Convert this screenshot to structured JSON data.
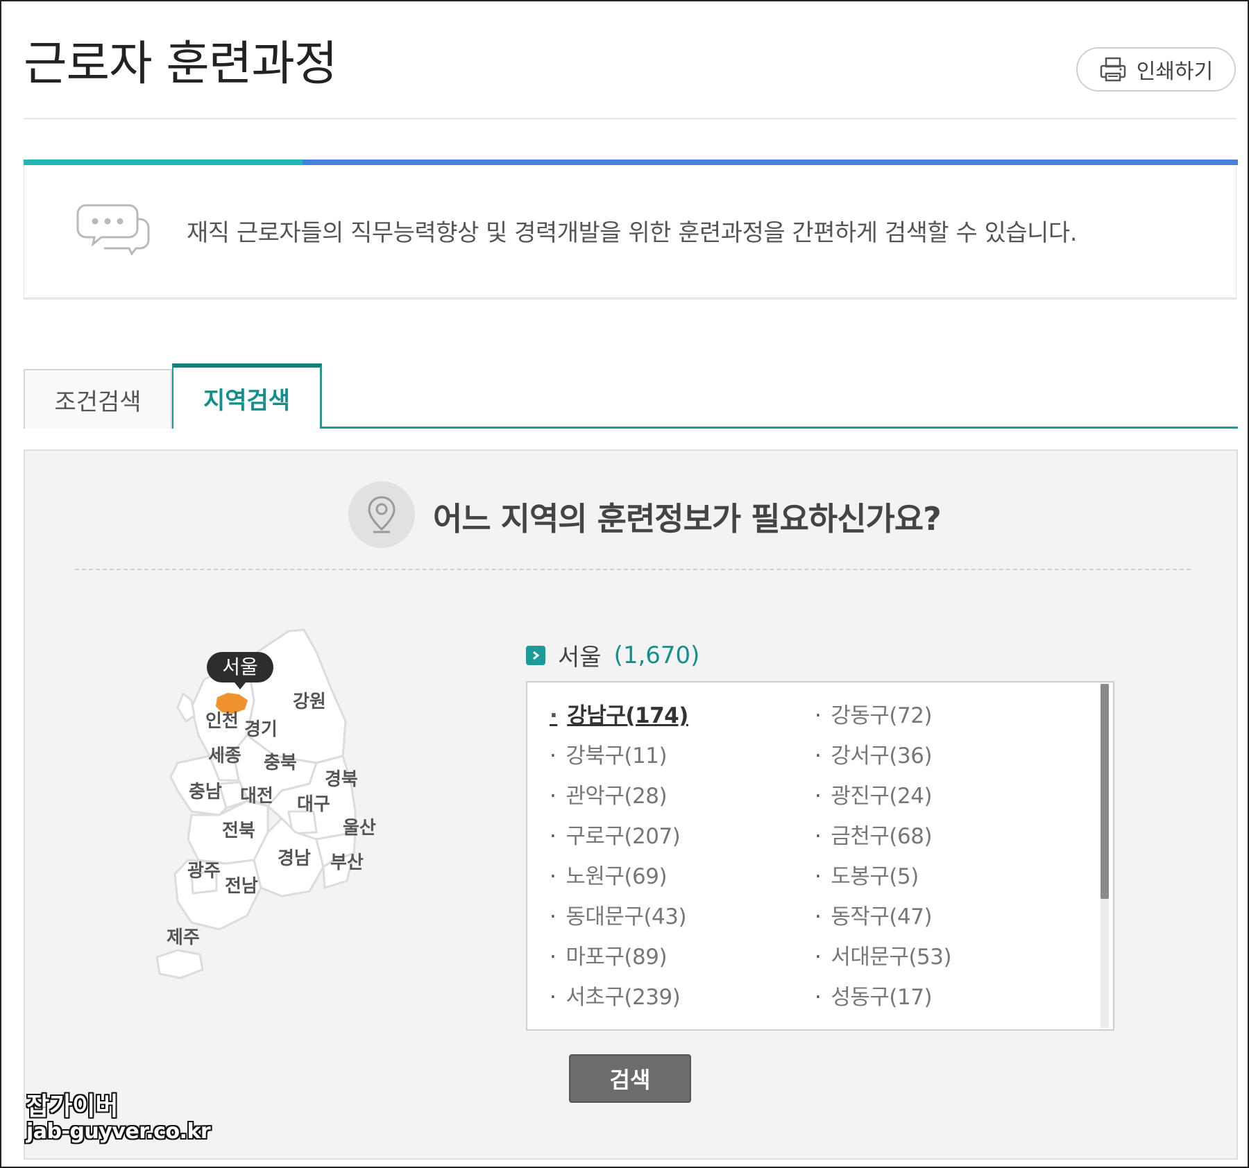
{
  "page": {
    "title": "근로자 훈련과정",
    "print_label": "인쇄하기"
  },
  "intro": {
    "message": "재직 근로자들의 직무능력향상 및 경력개발을 위한 훈련과정을 간편하게 검색할 수 있습니다."
  },
  "tabs": [
    {
      "label": "조건검색",
      "active": false
    },
    {
      "label": "지역검색",
      "active": true
    }
  ],
  "region_search": {
    "question": "어느 지역의 훈련정보가 필요하신가요?",
    "map": {
      "selected_region": "서울",
      "selected_color": "#f0922e",
      "regions": [
        "강원",
        "인천",
        "경기",
        "세종",
        "충북",
        "경북",
        "충남",
        "대전",
        "대구",
        "울산",
        "전북",
        "경남",
        "부산",
        "광주",
        "전남",
        "제주"
      ]
    },
    "selected": {
      "name": "서울",
      "count": "(1,670)"
    },
    "districts": [
      {
        "label": "강남구(174)",
        "selected": true
      },
      {
        "label": "강동구(72)"
      },
      {
        "label": "강북구(11)"
      },
      {
        "label": "강서구(36)"
      },
      {
        "label": "관악구(28)"
      },
      {
        "label": "광진구(24)"
      },
      {
        "label": "구로구(207)"
      },
      {
        "label": "금천구(68)"
      },
      {
        "label": "노원구(69)"
      },
      {
        "label": "도봉구(5)"
      },
      {
        "label": "동대문구(43)"
      },
      {
        "label": "동작구(47)"
      },
      {
        "label": "마포구(89)"
      },
      {
        "label": "서대문구(53)"
      },
      {
        "label": "서초구(239)"
      },
      {
        "label": "성동구(17)"
      }
    ],
    "search_label": "검색"
  },
  "watermark": {
    "line1": "잡가이버",
    "line2": "jab-guyver.co.kr"
  },
  "colors": {
    "teal": "#1eb9b3",
    "blue": "#4a7fd6",
    "tab_accent": "#13908c",
    "button": "#6c6c6c"
  }
}
